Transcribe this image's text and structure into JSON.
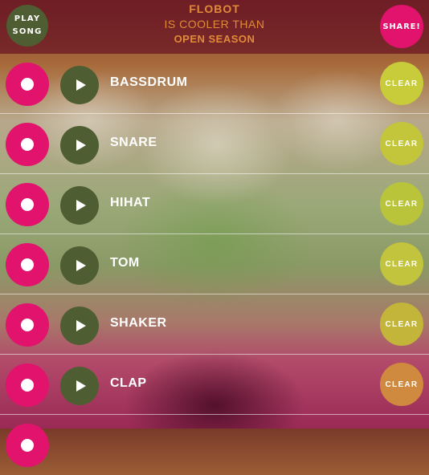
{
  "header": {
    "play_song_line1": "PLAY",
    "play_song_line2": "SONG",
    "title_line1": "FLOBOT",
    "title_line2": "IS COOLER THAN",
    "title_line3": "OPEN SEASON",
    "share_label": "SHARE!"
  },
  "tracks": [
    {
      "name": "BASSDRUM",
      "clear_label": "CLEAR",
      "clear_color": "#c8cb3a"
    },
    {
      "name": "SNARE",
      "clear_label": "CLEAR",
      "clear_color": "#c3c63a"
    },
    {
      "name": "HIHAT",
      "clear_label": "CLEAR",
      "clear_color": "#b9c43a"
    },
    {
      "name": "TOM",
      "clear_label": "CLEAR",
      "clear_color": "#c1c43c"
    },
    {
      "name": "SHAKER",
      "clear_label": "CLEAR",
      "clear_color": "#c3b43a"
    },
    {
      "name": "CLAP",
      "clear_label": "CLEAR",
      "clear_color": "#cf8a40"
    }
  ],
  "colors": {
    "record": "#e1136d",
    "play": "#4e5e32",
    "title": "#e08a3a",
    "topbar": "#69141f"
  },
  "icons": {
    "record": "record-dot-icon",
    "play": "play-triangle-icon"
  }
}
